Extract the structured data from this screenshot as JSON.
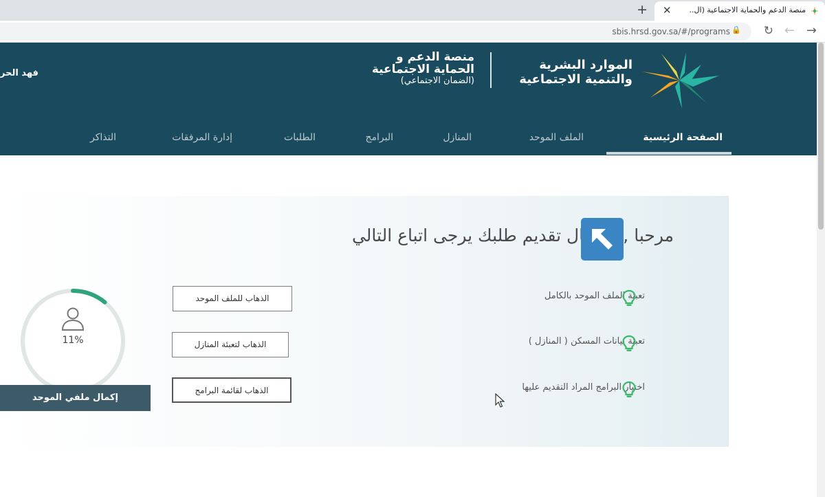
{
  "browser": {
    "tab_title": "منصة الدعم والحماية الاجتماعية (ال...",
    "close_glyph": "✕",
    "new_tab_glyph": "+",
    "url": "sbis.hrsd.gov.sa/#/programs",
    "lock_glyph": "🔒",
    "reload_glyph": "↻",
    "back_glyph": "←",
    "forward_glyph": "→"
  },
  "header": {
    "user_name": "فهد الحر",
    "ministry_line1": "الموارد البشرية",
    "ministry_line2": "والتنمية الاجتماعية",
    "platform_line1": "منصة الدعم و",
    "platform_line2": "الحماية الاجتماعية",
    "platform_line3": "(الضمان الاجتماعي)",
    "logo_colors": [
      "#2bb5a3",
      "#f6a623",
      "#e9d94a",
      "#1f8a70"
    ]
  },
  "nav": {
    "items": [
      {
        "label": "الصفحة الرئيسية",
        "active": true
      },
      {
        "label": "الملف الموحد",
        "active": false
      },
      {
        "label": "المنازل",
        "active": false
      },
      {
        "label": "البرامج",
        "active": false
      },
      {
        "label": "الطلبات",
        "active": false
      },
      {
        "label": "إدارة المرفقات",
        "active": false
      },
      {
        "label": "التذاكر",
        "active": false
      }
    ]
  },
  "main": {
    "welcome": "مرحبا  ,, لإكمال تقديم طلبك يرجى اتباع التالي",
    "steps": [
      {
        "text": "تعبئة الملف الموحد بالكامل",
        "button": "الذهاب للملف الموحد",
        "icon": "lightbulb-icon"
      },
      {
        "text": "تعبئة بيانات المسكن ( المنازل )",
        "button": "الذهاب لتعبئة المنازل",
        "icon": "lightbulb-icon"
      },
      {
        "text": "اختيار البرامج المراد التقديم عليها",
        "button": "الذهاب لقائمة البرامج",
        "icon": "lightbulb-icon"
      }
    ],
    "profile_progress": 0.11,
    "profile_progress_label": "11%",
    "complete_button": "إكمال ملفي الموحد"
  },
  "colors": {
    "header_bg": "#1a4a5e",
    "accent_green": "#2ea37e",
    "bulb_green": "#3db86a",
    "button_dark": "#3c5a68"
  }
}
